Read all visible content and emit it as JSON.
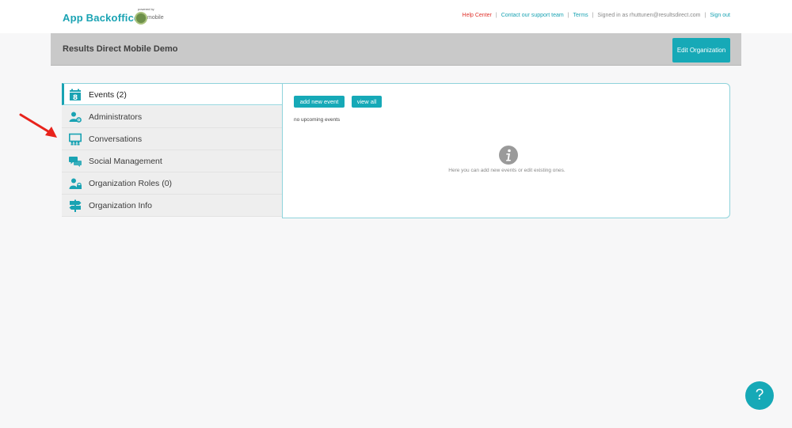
{
  "header": {
    "brand": "App Backoffice",
    "powered_by": "powered by",
    "partner_logo_text": "mobile",
    "links": {
      "help": "Help Center",
      "contact": "Contact our support team",
      "terms": "Terms",
      "signed_in": "Signed in as rhuttunen@resultsdirect.com",
      "signout": "Sign out"
    }
  },
  "org": {
    "title": "Results Direct Mobile Demo",
    "edit_label": "Edit Organization"
  },
  "sidebar": {
    "items": [
      {
        "label": "Events (2)",
        "icon": "calendar-icon",
        "active": true
      },
      {
        "label": "Administrators",
        "icon": "admin-gear-icon"
      },
      {
        "label": "Conversations",
        "icon": "presentation-icon"
      },
      {
        "label": "Social Management",
        "icon": "chat-bubbles-icon"
      },
      {
        "label": "Organization Roles (0)",
        "icon": "user-lock-icon"
      },
      {
        "label": "Organization Info",
        "icon": "signpost-icon"
      }
    ]
  },
  "main": {
    "add_event_label": "add new event",
    "view_all_label": "view all",
    "empty_text": "no upcoming events",
    "info_text": "Here you can add new events or edit existing ones."
  },
  "help_bubble": "?",
  "colors": {
    "accent": "#16a9b7",
    "help_link": "#e0332d",
    "annotation": "#e8231c"
  }
}
